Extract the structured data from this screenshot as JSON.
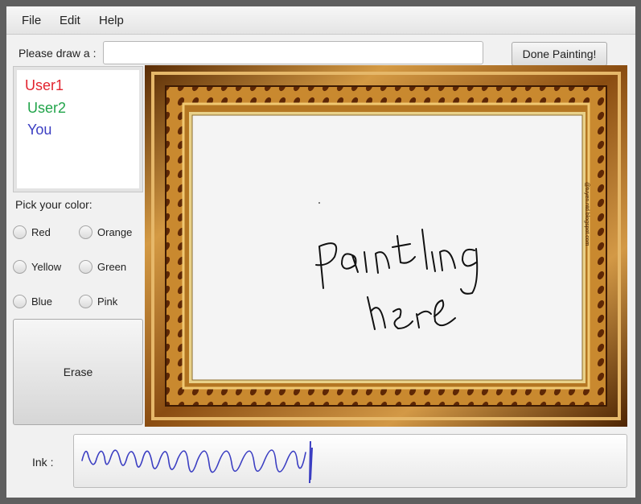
{
  "menu": {
    "file": "File",
    "edit": "Edit",
    "help": "Help"
  },
  "prompt": {
    "label": "Please draw a :",
    "input_value": "",
    "input_placeholder": ""
  },
  "done_button": "Done Painting!",
  "users": [
    {
      "name": "User1",
      "color": "#e2242f"
    },
    {
      "name": "User2",
      "color": "#21a44a"
    },
    {
      "name": "You",
      "color": "#3b3ec2"
    }
  ],
  "color_picker": {
    "label": "Pick your color:",
    "options": [
      "Red",
      "Orange",
      "Yellow",
      "Green",
      "Blue",
      "Pink"
    ]
  },
  "erase_button": "Erase",
  "canvas": {
    "drawn_text": "painting here",
    "frame_watermark": "@tuyen.ntd.blogspot.com"
  },
  "ink": {
    "label": "Ink :",
    "color": "#3b3ec2"
  }
}
